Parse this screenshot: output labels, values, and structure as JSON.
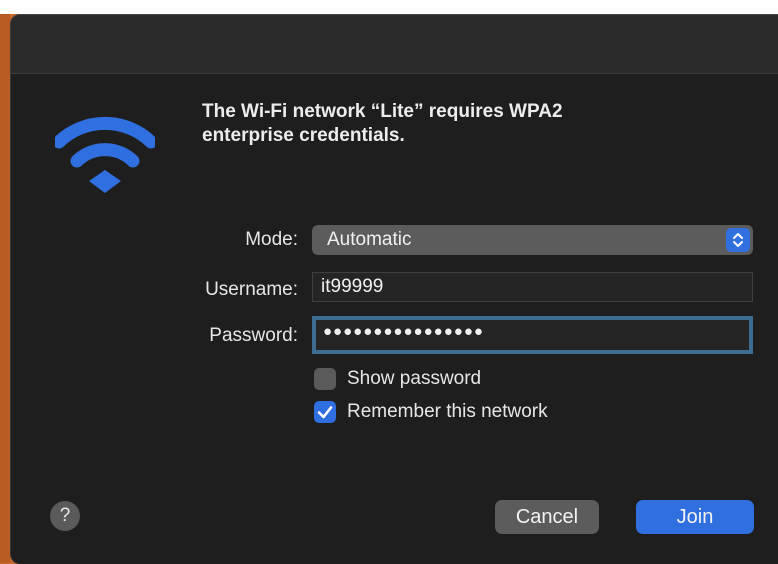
{
  "dialog": {
    "heading_line1": "The Wi-Fi network “Lite” requires WPA2",
    "heading_line2": "enterprise credentials.",
    "icon": "wifi-icon",
    "accent_color": "#2f6fe0"
  },
  "form": {
    "mode_label": "Mode:",
    "mode_value": "Automatic",
    "username_label": "Username:",
    "username_value": "it99999",
    "password_label": "Password:",
    "password_masked": "●●●●●●●●●●●●●●●●"
  },
  "options": {
    "show_password_label": "Show password",
    "show_password_checked": false,
    "remember_label": "Remember this network",
    "remember_checked": true
  },
  "buttons": {
    "help": "?",
    "cancel": "Cancel",
    "join": "Join"
  }
}
